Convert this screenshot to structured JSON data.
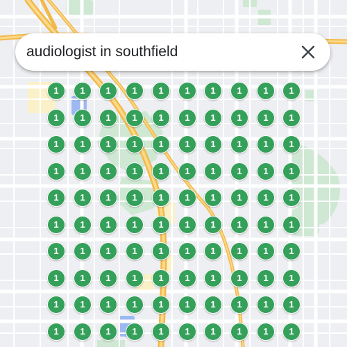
{
  "search": {
    "query": "audiologist in southfield"
  },
  "icons": {
    "close": "close-icon"
  },
  "colors": {
    "pin_fill": "#34a05a",
    "pin_text": "#ffffff",
    "map_background": "#f0f1f3",
    "highway": "#f7c95c",
    "park": "#cfe8d3",
    "water": "#9db8f2"
  },
  "results": {
    "rows": 10,
    "columns": 10,
    "pin_label": "1"
  }
}
